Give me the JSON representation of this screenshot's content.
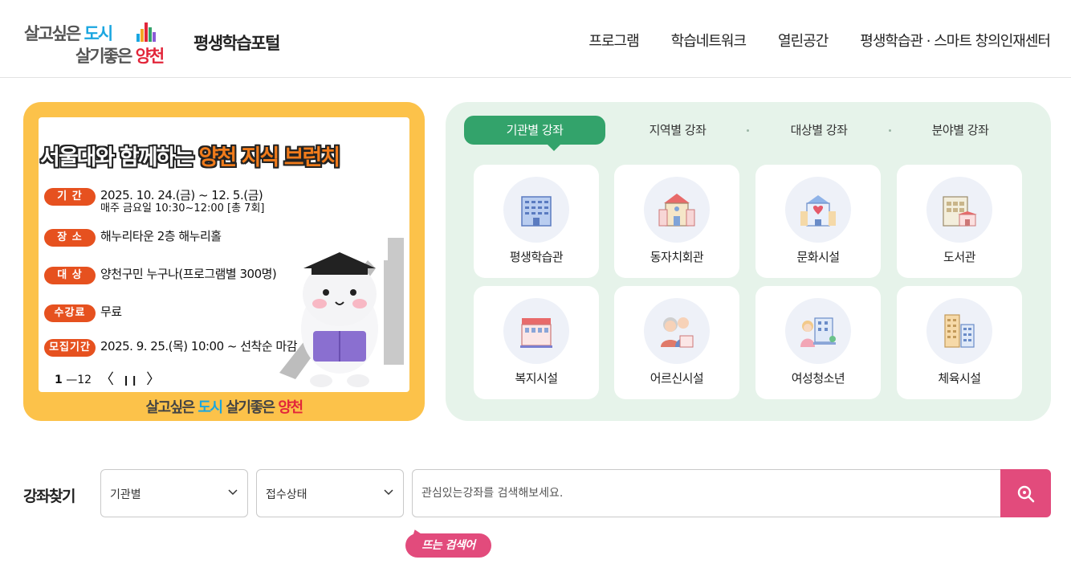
{
  "header": {
    "logo": {
      "line1_a": "살고싶은 ",
      "line1_b": "도시",
      "line2_a": "살기좋은 ",
      "line2_b": "양천"
    },
    "portal_title": "평생학습포털",
    "nav": [
      "프로그램",
      "학습네트워크",
      "열린공간",
      "평생학습관 · 스마트 창의인재센터"
    ]
  },
  "banner": {
    "title_a": "서울대와 함께하는 ",
    "title_b": "양천 지식 브런치",
    "rows": [
      {
        "badge": "기 간",
        "text": "2025. 10. 24.(금) ~ 12. 5.(금)",
        "sub": "매주 금요일 10:30~12:00 [총 7회]"
      },
      {
        "badge": "장 소",
        "text": "해누리타운 2층 해누리홀"
      },
      {
        "badge": "대 상",
        "text": "양천구민 누구나(프로그램별 300명)"
      },
      {
        "badge": "수강료",
        "text": "무료"
      },
      {
        "badge": "모집기간",
        "text": "2025. 9. 25.(목) 10:00 ~ 선착순 마감"
      }
    ],
    "slide_current": "1",
    "slide_sep": "—",
    "slide_total": "12",
    "prev": "〈",
    "pause": "❙❙",
    "next": "〉",
    "footer_a": "살고싶은 ",
    "footer_b": "도시",
    "footer_c": " 살기좋은 ",
    "footer_d": "양천"
  },
  "category": {
    "tabs": [
      "기관별 강좌",
      "지역별 강좌",
      "대상별 강좌",
      "분야별 강좌"
    ],
    "active_tab": 0,
    "cards": [
      {
        "label": "평생학습관",
        "icon": "office-building-icon"
      },
      {
        "label": "동자치회관",
        "icon": "community-center-icon"
      },
      {
        "label": "문화시설",
        "icon": "culture-facility-icon"
      },
      {
        "label": "도서관",
        "icon": "library-icon"
      },
      {
        "label": "복지시설",
        "icon": "welfare-facility-icon"
      },
      {
        "label": "어르신시설",
        "icon": "senior-facility-icon"
      },
      {
        "label": "여성청소년",
        "icon": "women-youth-icon"
      },
      {
        "label": "체육시설",
        "icon": "sports-facility-icon"
      }
    ]
  },
  "search": {
    "label": "강좌찾기",
    "select1": "기관별",
    "select2": "접수상태",
    "placeholder": "관심있는강좌를 검색해보세요.",
    "hot_badge": "뜨는 검색어"
  },
  "colors": {
    "banner_bg": "#fcc24a",
    "accent_orange": "#e6511f",
    "panel_bg": "#e6f3ea",
    "tab_active": "#33a36b",
    "search_btn": "#e24b7c"
  }
}
